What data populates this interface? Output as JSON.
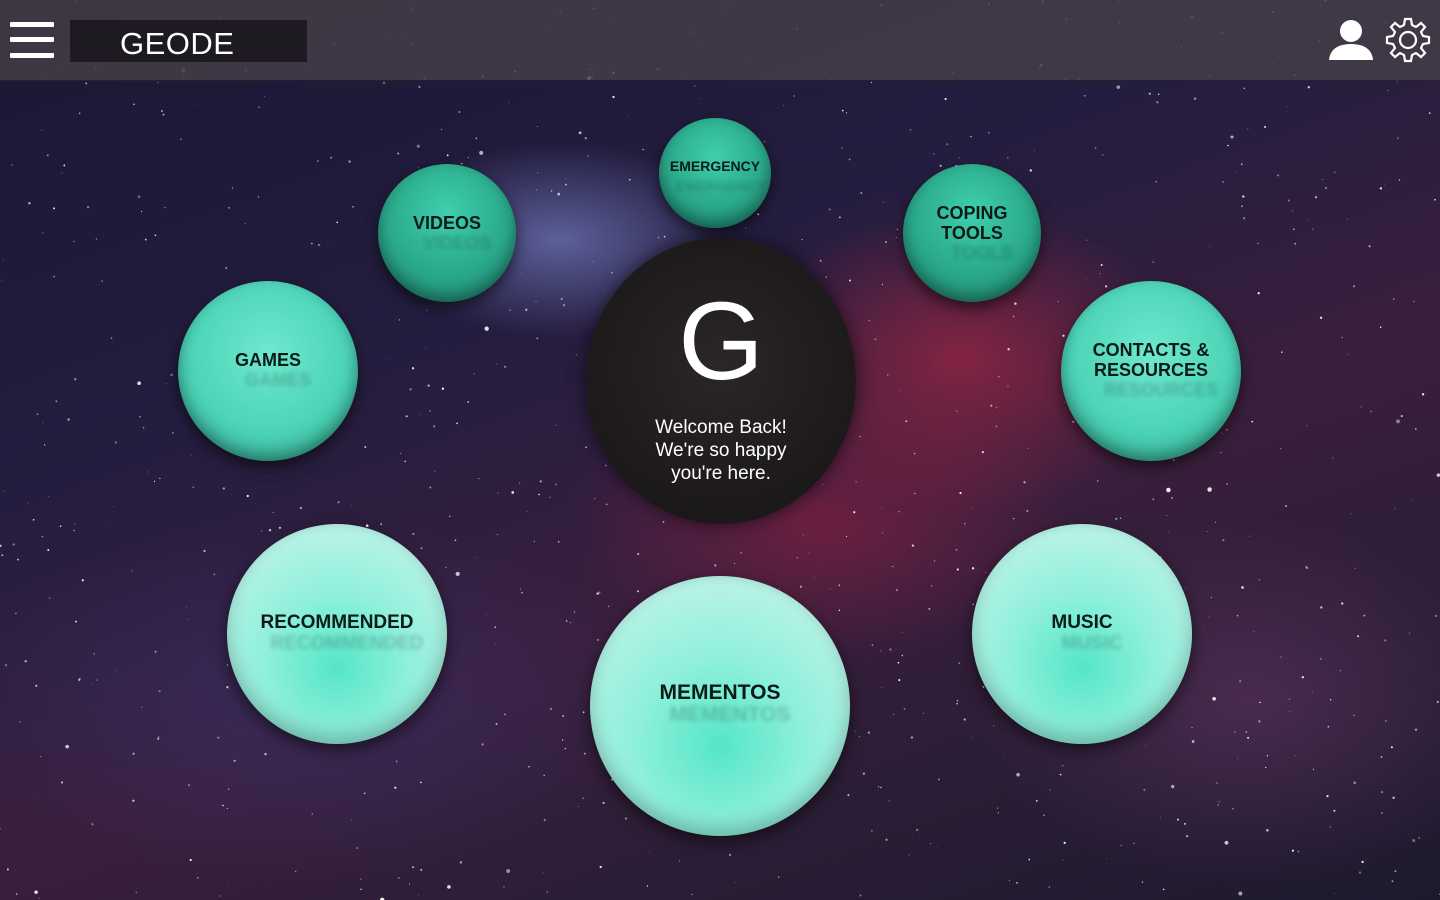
{
  "header": {
    "app_title": "GEODE",
    "menu_icon": "hamburger-menu-icon",
    "user_icon": "user-profile-icon",
    "settings_icon": "gear-icon"
  },
  "center": {
    "letter": "G",
    "message_line1": "Welcome Back!",
    "message_line2": "We're so happy",
    "message_line3": "you're here."
  },
  "bubbles": {
    "emergency": "EMERGENCY",
    "videos": "VIDEOS",
    "coping_tools_line1": "COPING",
    "coping_tools_line2": "TOOLS",
    "games": "GAMES",
    "contacts_line1": "CONTACTS &",
    "contacts_line2": "RESOURCES",
    "recommended": "RECOMMENDED",
    "mementos": "MEMENTOS",
    "music": "MUSIC"
  },
  "colors": {
    "bubble_dark": "#2aa88a",
    "bubble_mid": "#4dd4b7",
    "bubble_light": "#8ff0dc",
    "center": "#1c191b",
    "topbar": "#463e48"
  }
}
